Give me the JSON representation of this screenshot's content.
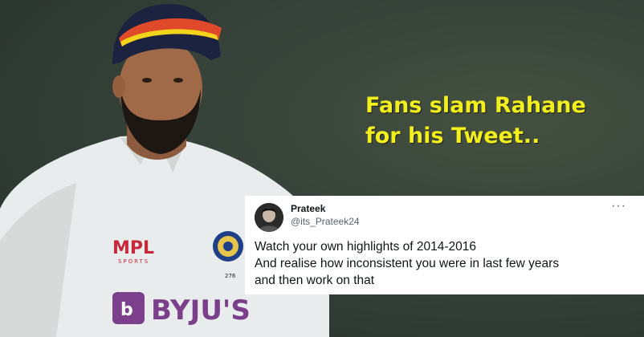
{
  "headline": {
    "line1": "Fans slam Rahane",
    "line2": "for his Tweet.."
  },
  "shirt": {
    "sponsor1": "MPL",
    "sponsor1_sub": "SPORTS",
    "sponsor2": "BYJU'S",
    "badge_number": "276"
  },
  "tweet": {
    "display_name": "Prateek",
    "handle": "@its_Prateek24",
    "more_icon": "more-dots-icon",
    "lines": [
      "Watch your own highlights of 2014-2016",
      "And realise how inconsistent you were in last few years",
      "and then work on that"
    ]
  },
  "colors": {
    "headline": "#f2ef1d",
    "background": "#36423a",
    "shirt": "#ecefee",
    "mpl_red": "#c8293a",
    "byjus_purple": "#7b3f8c"
  }
}
